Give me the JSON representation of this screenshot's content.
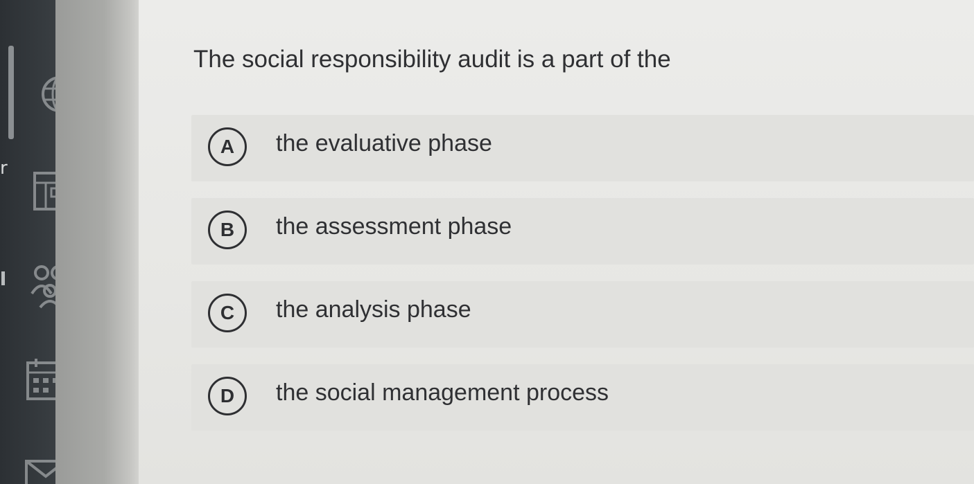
{
  "side_rail": {
    "cut_letter": "r",
    "icons": [
      "globe-icon",
      "layout-icon",
      "users-icon",
      "calendar-icon",
      "mail-icon"
    ]
  },
  "question": {
    "text": "The social responsibility audit is a part of the"
  },
  "options": [
    {
      "letter": "A",
      "text": "the evaluative phase"
    },
    {
      "letter": "B",
      "text": "the assessment phase"
    },
    {
      "letter": "C",
      "text": "the analysis phase"
    },
    {
      "letter": "D",
      "text": "the social management process"
    }
  ]
}
